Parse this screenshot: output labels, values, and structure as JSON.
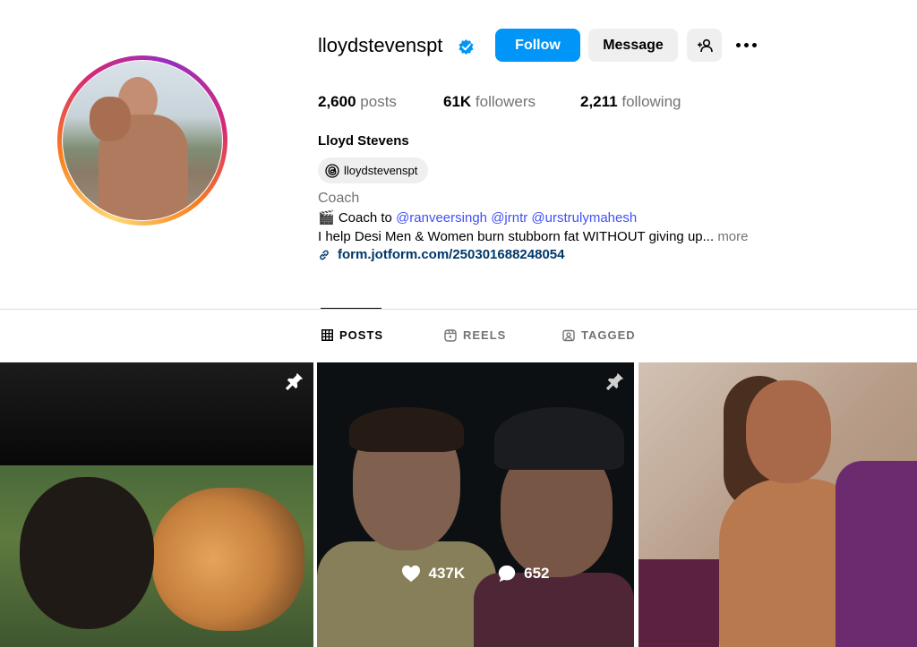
{
  "profile": {
    "username": "lloydstevenspt",
    "full_name": "Lloyd Stevens",
    "threads_handle": "lloydstevenspt",
    "category": "Coach",
    "bio_line1_prefix": "🎬 Coach to ",
    "bio_mentions": [
      "@ranveersingh",
      "@jrntr",
      "@urstrulymahesh"
    ],
    "bio_line2": "I help Desi Men & Women burn stubborn fat WITHOUT giving up...",
    "bio_more": "more",
    "link": "form.jotform.com/250301688248054"
  },
  "actions": {
    "follow": "Follow",
    "message": "Message"
  },
  "stats": {
    "posts_count": "2,600",
    "posts_label": "posts",
    "followers_count": "61K",
    "followers_label": "followers",
    "following_count": "2,211",
    "following_label": "following"
  },
  "tabs": {
    "posts": "POSTS",
    "reels": "REELS",
    "tagged": "TAGGED",
    "active": "posts"
  },
  "grid": {
    "posts": [
      {
        "pinned": true
      },
      {
        "pinned": true,
        "likes": "437K",
        "comments": "652"
      },
      {
        "pinned": false
      }
    ]
  },
  "colors": {
    "accent": "#0095f6",
    "verified": "#0095f6",
    "mention": "#4150f7",
    "link": "#00376b"
  },
  "icons": {
    "verified": "verified-badge-icon",
    "add_user": "person-add-icon",
    "more": "more-horizontal-icon",
    "threads": "threads-icon",
    "link": "link-icon",
    "posts_tab": "grid-icon",
    "reels_tab": "reels-icon",
    "tagged_tab": "tagged-icon",
    "pin": "pin-icon",
    "likes": "heart-icon",
    "comments": "comment-icon"
  }
}
